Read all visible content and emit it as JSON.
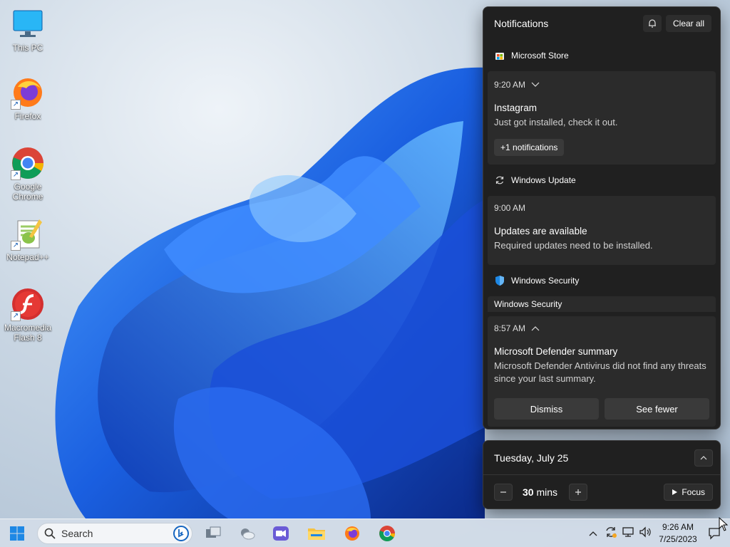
{
  "desktop": {
    "icons": [
      {
        "label": "This PC"
      },
      {
        "label": "Firefox"
      },
      {
        "label": "Google Chrome"
      },
      {
        "label": "Notepad++"
      },
      {
        "label": "Macromedia Flash 8"
      }
    ]
  },
  "notifications": {
    "title": "Notifications",
    "clear_all": "Clear all",
    "groups": [
      {
        "app": "Microsoft Store",
        "time": "9:20 AM",
        "title": "Instagram",
        "body": "Just got installed, check it out.",
        "more": "+1 notifications"
      },
      {
        "app": "Windows Update",
        "time": "9:00 AM",
        "title": "Updates are available",
        "body": "Required updates need to be installed."
      },
      {
        "app": "Windows Security",
        "sublabel": "Windows Security",
        "time": "8:57 AM",
        "title": "Microsoft Defender summary",
        "body": "Microsoft Defender Antivirus did not find any threats since your last summary.",
        "action_1": "Dismiss",
        "action_2": "See fewer"
      }
    ]
  },
  "calendar": {
    "date": "Tuesday, July 25",
    "focus_value": "30",
    "focus_unit": "mins",
    "focus_button": "Focus"
  },
  "taskbar": {
    "search_placeholder": "Search",
    "clock_time": "9:26 AM",
    "clock_date": "7/25/2023"
  },
  "colors": {
    "accent": "#1a73e8",
    "panel_bg": "#202020",
    "card_bg": "#2b2b2b"
  }
}
